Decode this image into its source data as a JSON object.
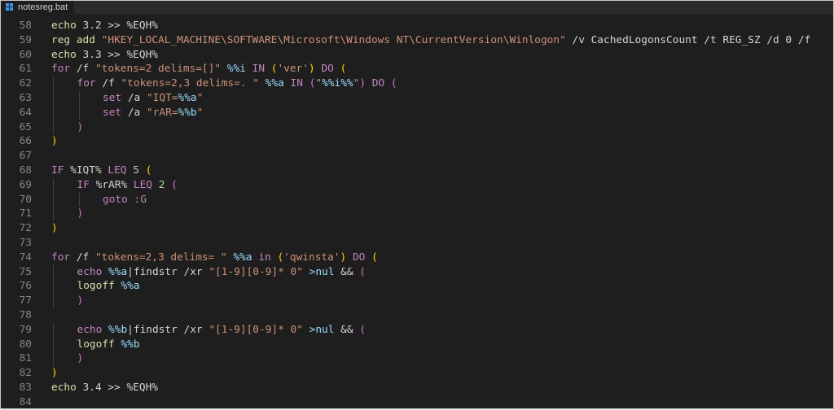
{
  "tab": {
    "title": "notesreg.bat",
    "icon": "windows-logo-icon"
  },
  "colors": {
    "background": "#1e1e1e",
    "line_number": "#858585",
    "keyword": "#c586c0",
    "string": "#ce9178",
    "variable": "#9cdcfe",
    "number": "#b5cea8",
    "bracket_gold": "#ffd700",
    "bracket_purple": "#da70d6",
    "bracket_blue": "#179fff"
  },
  "lines": [
    {
      "n": "58",
      "indent": 0,
      "tokens": [
        [
          "cmd",
          "echo"
        ],
        [
          "vv",
          " 3.2 >> %EQH%"
        ]
      ]
    },
    {
      "n": "59",
      "indent": 0,
      "tokens": [
        [
          "cmd",
          "reg add"
        ],
        [
          "vv",
          " "
        ],
        [
          "str",
          "\"HKEY_LOCAL_MACHINE\\SOFTWARE\\Microsoft\\Windows NT\\CurrentVersion\\Winlogon\""
        ],
        [
          "vv",
          " /v CachedLogonsCount /t REG_SZ /d 0 /f"
        ]
      ]
    },
    {
      "n": "60",
      "indent": 0,
      "tokens": [
        [
          "cmd",
          "echo"
        ],
        [
          "vv",
          " 3.3 >> %EQH%"
        ]
      ]
    },
    {
      "n": "61",
      "indent": 0,
      "tokens": [
        [
          "kw",
          "for"
        ],
        [
          "vv",
          " /f "
        ],
        [
          "str",
          "\"tokens=2 delims=[]\""
        ],
        [
          "vv",
          " "
        ],
        [
          "var",
          "%%i"
        ],
        [
          "vv",
          " "
        ],
        [
          "kw",
          "IN"
        ],
        [
          "vv",
          " "
        ],
        [
          "b1",
          "("
        ],
        [
          "str",
          "'ver'"
        ],
        [
          "b1",
          ")"
        ],
        [
          "vv",
          " "
        ],
        [
          "kw",
          "DO"
        ],
        [
          "vv",
          " "
        ],
        [
          "b1",
          "("
        ]
      ]
    },
    {
      "n": "62",
      "indent": 1,
      "tokens": [
        [
          "kw",
          "for"
        ],
        [
          "vv",
          " /f "
        ],
        [
          "str",
          "\"tokens=2,3 delims=. \""
        ],
        [
          "vv",
          " "
        ],
        [
          "var",
          "%%a"
        ],
        [
          "vv",
          " "
        ],
        [
          "kw",
          "IN"
        ],
        [
          "vv",
          " "
        ],
        [
          "b2",
          "("
        ],
        [
          "str",
          "\""
        ],
        [
          "var",
          "%%i%%"
        ],
        [
          "str",
          "\""
        ],
        [
          "b2",
          ")"
        ],
        [
          "vv",
          " "
        ],
        [
          "kw",
          "DO"
        ],
        [
          "vv",
          " "
        ],
        [
          "b2",
          "("
        ]
      ]
    },
    {
      "n": "63",
      "indent": 2,
      "tokens": [
        [
          "kw",
          "set"
        ],
        [
          "vv",
          " /a "
        ],
        [
          "str",
          "\"IQT="
        ],
        [
          "var",
          "%%a"
        ],
        [
          "str",
          "\""
        ]
      ]
    },
    {
      "n": "64",
      "indent": 2,
      "tokens": [
        [
          "kw",
          "set"
        ],
        [
          "vv",
          " /a "
        ],
        [
          "str",
          "\"rAR="
        ],
        [
          "var",
          "%%b"
        ],
        [
          "str",
          "\""
        ]
      ]
    },
    {
      "n": "65",
      "indent": 1,
      "tokens": [
        [
          "b2",
          ")"
        ]
      ]
    },
    {
      "n": "66",
      "indent": 0,
      "tokens": [
        [
          "b1",
          ")"
        ]
      ]
    },
    {
      "n": "67",
      "indent": 0,
      "tokens": []
    },
    {
      "n": "68",
      "indent": 0,
      "tokens": [
        [
          "kw",
          "IF"
        ],
        [
          "vv",
          " %IQT% "
        ],
        [
          "kw",
          "LEQ"
        ],
        [
          "vv",
          " "
        ],
        [
          "num",
          "5"
        ],
        [
          "vv",
          " "
        ],
        [
          "b1",
          "("
        ]
      ]
    },
    {
      "n": "69",
      "indent": 1,
      "tokens": [
        [
          "kw",
          "IF"
        ],
        [
          "vv",
          " %rAR% "
        ],
        [
          "kw",
          "LEQ"
        ],
        [
          "vv",
          " "
        ],
        [
          "num",
          "2"
        ],
        [
          "vv",
          " "
        ],
        [
          "b2",
          "("
        ]
      ]
    },
    {
      "n": "70",
      "indent": 2,
      "tokens": [
        [
          "kw",
          "goto"
        ],
        [
          "vv",
          " "
        ],
        [
          "kw",
          ":G"
        ]
      ]
    },
    {
      "n": "71",
      "indent": 1,
      "tokens": [
        [
          "b2",
          ")"
        ]
      ]
    },
    {
      "n": "72",
      "indent": 0,
      "tokens": [
        [
          "b1",
          ")"
        ]
      ]
    },
    {
      "n": "73",
      "indent": 0,
      "tokens": []
    },
    {
      "n": "74",
      "indent": 0,
      "tokens": [
        [
          "kw",
          "for"
        ],
        [
          "vv",
          " /f "
        ],
        [
          "str",
          "\"tokens=2,3 delims= \""
        ],
        [
          "vv",
          " "
        ],
        [
          "var",
          "%%a"
        ],
        [
          "vv",
          " "
        ],
        [
          "kw",
          "in"
        ],
        [
          "vv",
          " "
        ],
        [
          "b1",
          "("
        ],
        [
          "str",
          "'qwinsta'"
        ],
        [
          "b1",
          ")"
        ],
        [
          "vv",
          " "
        ],
        [
          "kw",
          "DO"
        ],
        [
          "vv",
          " "
        ],
        [
          "b1",
          "("
        ]
      ]
    },
    {
      "n": "75",
      "indent": 1,
      "tokens": [
        [
          "kw",
          "echo"
        ],
        [
          "vv",
          " "
        ],
        [
          "var",
          "%%a"
        ],
        [
          "vv",
          "|findstr /xr "
        ],
        [
          "str",
          "\"[1-9][0-9]* 0\""
        ],
        [
          "vv",
          " "
        ],
        [
          "var",
          ">nul"
        ],
        [
          "vv",
          " && "
        ],
        [
          "b2",
          "("
        ]
      ]
    },
    {
      "n": "76",
      "indent": 1,
      "tokens": [
        [
          "cmd",
          "logoff"
        ],
        [
          "vv",
          " "
        ],
        [
          "var",
          "%%a"
        ]
      ]
    },
    {
      "n": "77",
      "indent": 1,
      "tokens": [
        [
          "b2",
          ")"
        ]
      ]
    },
    {
      "n": "78",
      "indent": 0,
      "tokens": []
    },
    {
      "n": "79",
      "indent": 1,
      "tokens": [
        [
          "kw",
          "echo"
        ],
        [
          "vv",
          " "
        ],
        [
          "var",
          "%%b"
        ],
        [
          "vv",
          "|findstr /xr "
        ],
        [
          "str",
          "\"[1-9][0-9]* 0\""
        ],
        [
          "vv",
          " "
        ],
        [
          "var",
          ">nul"
        ],
        [
          "vv",
          " && "
        ],
        [
          "b2",
          "("
        ]
      ]
    },
    {
      "n": "80",
      "indent": 1,
      "tokens": [
        [
          "cmd",
          "logoff"
        ],
        [
          "vv",
          " "
        ],
        [
          "var",
          "%%b"
        ]
      ]
    },
    {
      "n": "81",
      "indent": 1,
      "tokens": [
        [
          "b2",
          ")"
        ]
      ]
    },
    {
      "n": "82",
      "indent": 0,
      "tokens": [
        [
          "b1",
          ")"
        ]
      ]
    },
    {
      "n": "83",
      "indent": 0,
      "tokens": [
        [
          "cmd",
          "echo"
        ],
        [
          "vv",
          " 3.4 >> %EQH%"
        ]
      ]
    },
    {
      "n": "84",
      "indent": 0,
      "tokens": []
    }
  ]
}
